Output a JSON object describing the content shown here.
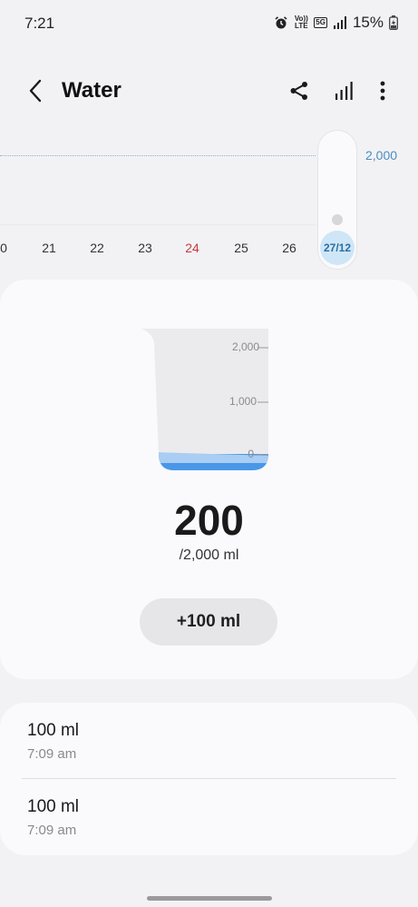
{
  "status": {
    "time": "7:21",
    "volte_label": "Vo)) LTE",
    "network_label": "5G",
    "battery_percent": "15%"
  },
  "header": {
    "title": "Water"
  },
  "chart": {
    "goal_label": "2,000",
    "days": [
      {
        "label": "0",
        "weekend": false
      },
      {
        "label": "21",
        "weekend": false
      },
      {
        "label": "22",
        "weekend": false
      },
      {
        "label": "23",
        "weekend": false
      },
      {
        "label": "24",
        "weekend": true
      },
      {
        "label": "25",
        "weekend": false
      },
      {
        "label": "26",
        "weekend": false
      }
    ],
    "selected_day": "27/12"
  },
  "cup": {
    "ticks": [
      "2,000",
      "1,000",
      "0"
    ],
    "fill_fraction": 0.1
  },
  "summary": {
    "amount": "200",
    "goal_text": "/2,000 ml",
    "add_button_label": "+100 ml"
  },
  "log": [
    {
      "amount": "100 ml",
      "time": "7:09 am"
    },
    {
      "amount": "100 ml",
      "time": "7:09 am"
    }
  ],
  "colors": {
    "accent": "#4a8ec0",
    "water": "#4a97e8",
    "weekend": "#c63b3b"
  }
}
